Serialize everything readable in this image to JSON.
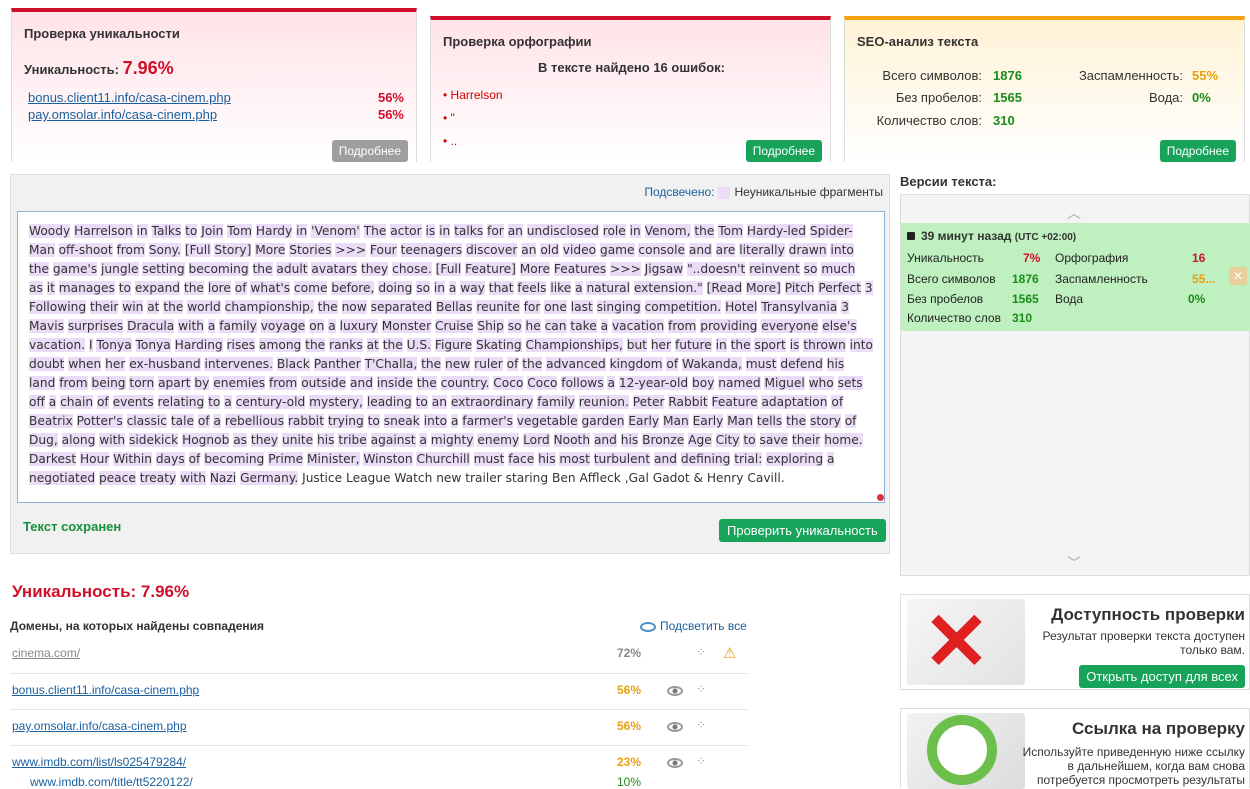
{
  "uniq_panel": {
    "title": "Проверка уникальности",
    "label": "Уникальность:",
    "value": "7.96%",
    "links": [
      {
        "url": "bonus.client11.info/casa-cinem.php",
        "pct": "56%"
      },
      {
        "url": "pay.omsolar.info/casa-cinem.php",
        "pct": "56%"
      }
    ],
    "more": "Подробнее"
  },
  "ortho_panel": {
    "title": "Проверка орфографии",
    "summary": "В тексте найдено 16 ошибок:",
    "errors": [
      "Harrelson",
      "\"",
      ".."
    ],
    "more": "Подробнее"
  },
  "seo_panel": {
    "title": "SEO-анализ текста",
    "items": [
      {
        "label": "Всего символов:",
        "value": "1876"
      },
      {
        "label": "Без пробелов:",
        "value": "1565"
      },
      {
        "label": "Количество слов:",
        "value": "310"
      },
      {
        "label": "Заспамленность:",
        "value": "55%"
      },
      {
        "label": "Вода:",
        "value": "0%"
      }
    ],
    "more": "Подробнее"
  },
  "editor": {
    "highlight_label": "Подсвечено:",
    "legend": "Неуникальные фрагменты",
    "saved": "Текст сохранен",
    "check_button": "Проверить уникальность",
    "text": "Woody Harrelson in Talks to Join Tom Hardy in 'Venom' The actor is in talks for an undisclosed role in Venom, the Tom Hardy-led Spider-Man off-shoot from Sony. [Full Story] More Stories >>> Four teenagers discover an old video game console and are literally drawn into the game's jungle setting becoming the adult avatars they chose. [Full Feature] More Features >>> Jigsaw \"..doesn't reinvent so much as it manages to expand the lore of what's come before, doing so in a way that feels like a natural extension.\" [Read More] Pitch Perfect 3 Following their win at the world championship, the now separated Bellas reunite for one last singing competition. Hotel Transylvania 3 Mavis surprises Dracula with a family voyage on a luxury Monster Cruise Ship so he can take a vacation from providing everyone else's vacation. I Tonya Tonya Harding rises among the ranks at the U.S. Figure Skating Championships, but her future in the sport is thrown into doubt when her ex-husband intervenes. Black Panther T'Challa, the new ruler of the advanced kingdom of Wakanda, must defend his land from being torn apart by enemies from outside and inside the country. Coco Coco follows a 12-year-old boy named Miguel who sets off a chain of events relating to a century-old mystery, leading to an extraordinary family reunion. Peter Rabbit Feature adaptation of Beatrix Potter's classic tale of a rebellious rabbit trying to sneak into a farmer's vegetable garden Early Man Early Man tells the story of Dug, along with sidekick Hognob as they unite his tribe against a mighty enemy Lord Nooth and his Bronze Age City to save their home. Darkest Hour Within days of becoming Prime Minister, Winston Churchill must face his most turbulent and defining trial: exploring a negotiated peace treaty with Nazi Germany. Justice League Watch new trailer staring Ben Affleck ,Gal Gadot & Henry Cavill."
  },
  "versions": {
    "title": "Версии текста:",
    "time": "39 минут назад",
    "tz": "(UTC +02:00)",
    "rows": [
      {
        "label": "Уникальность",
        "value": "7%"
      },
      {
        "label": "Всего символов",
        "value": "1876"
      },
      {
        "label": "Без пробелов",
        "value": "1565"
      },
      {
        "label": "Количество слов",
        "value": "310"
      },
      {
        "label": "Орфография",
        "value": "16"
      },
      {
        "label": "Заспамленность",
        "value": "55..."
      },
      {
        "label": "Вода",
        "value": "0%"
      }
    ]
  },
  "results": {
    "title": "Уникальность: 7.96%",
    "domains_head": "Домены, на которых найдены совпадения",
    "highlight_all": "Подсветить все",
    "rows": [
      {
        "domain": "cinema.com/",
        "pct": "72%",
        "color": "#888888"
      },
      {
        "domain": "bonus.client11.info/casa-cinem.php",
        "pct": "56%",
        "color": "#e8a010"
      },
      {
        "domain": "pay.omsolar.info/casa-cinem.php",
        "pct": "56%",
        "color": "#e8a010"
      },
      {
        "domain": "www.imdb.com/list/ls025479284/",
        "pct": "23%",
        "color": "#e8a010"
      },
      {
        "domain": "www.imdb.com/title/tt5220122/",
        "pct": "10%",
        "color": "#1a8c1a"
      }
    ]
  },
  "access": {
    "title": "Доступность проверки",
    "text": "Результат проверки текста доступен только вам.",
    "button": "Открыть доступ для всех"
  },
  "link": {
    "title": "Ссылка на проверку",
    "text": "Используйте приведенную ниже ссылку в дальнейшем, когда вам снова потребуется просмотреть результаты"
  },
  "colors": {
    "accent": "#d0102a",
    "green": "#17a35a",
    "highlight": "#eadcf7"
  }
}
